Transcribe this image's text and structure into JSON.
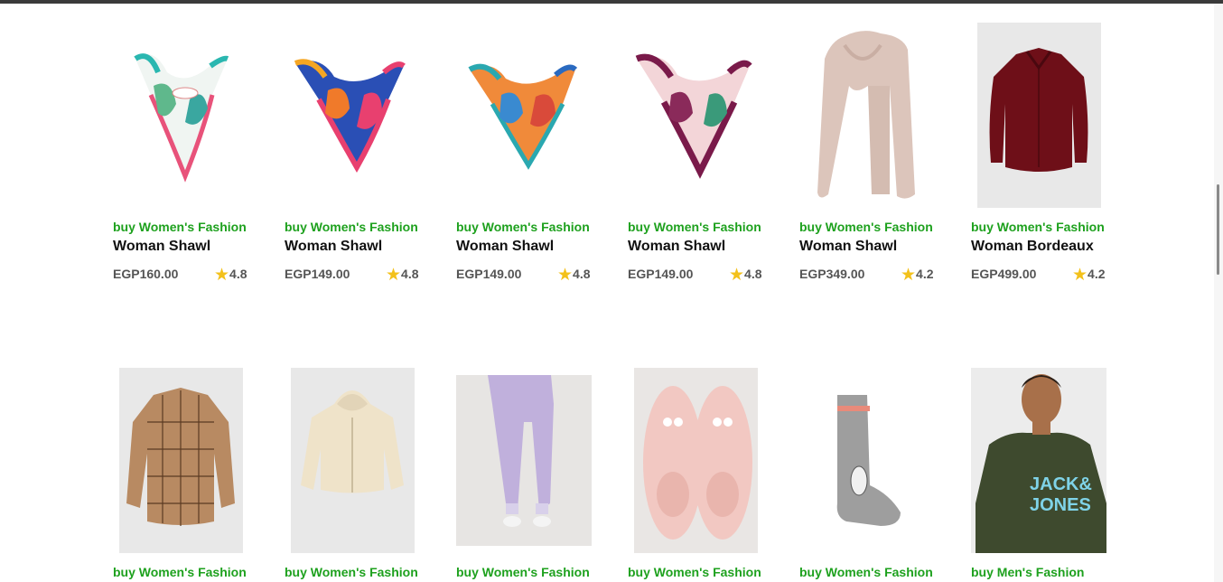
{
  "products": [
    {
      "category": "buy Women's Fashion",
      "title": "Woman Shawl",
      "price": "EGP160.00",
      "rating": "4.8",
      "image": "scarf-white-teal-pink"
    },
    {
      "category": "buy Women's Fashion",
      "title": "Woman Shawl",
      "price": "EGP149.00",
      "rating": "4.8",
      "image": "scarf-blue-pink"
    },
    {
      "category": "buy Women's Fashion",
      "title": "Woman Shawl",
      "price": "EGP149.00",
      "rating": "4.8",
      "image": "scarf-orange-teal"
    },
    {
      "category": "buy Women's Fashion",
      "title": "Woman Shawl",
      "price": "EGP149.00",
      "rating": "4.8",
      "image": "scarf-burgundy-pink"
    },
    {
      "category": "buy Women's Fashion",
      "title": "Woman Shawl",
      "price": "EGP349.00",
      "rating": "4.2",
      "image": "shawl-beige"
    },
    {
      "category": "buy Women's Fashion",
      "title": "Woman Bordeaux",
      "price": "EGP499.00",
      "rating": "4.2",
      "image": "blouse-bordeaux"
    },
    {
      "category": "buy Women's Fashion",
      "image": "shirt-plaid-brown"
    },
    {
      "category": "buy Women's Fashion",
      "image": "hoodie-cream"
    },
    {
      "category": "buy Women's Fashion",
      "image": "sweatpants-lilac"
    },
    {
      "category": "buy Women's Fashion",
      "image": "slippers-pink"
    },
    {
      "category": "buy Women's Fashion",
      "image": "sock-grey"
    },
    {
      "category": "buy Men's Fashion",
      "image": "tshirt-olive-jack-jones"
    }
  ],
  "colors": {
    "category": "#1ea11e",
    "star": "#f3c11b"
  }
}
